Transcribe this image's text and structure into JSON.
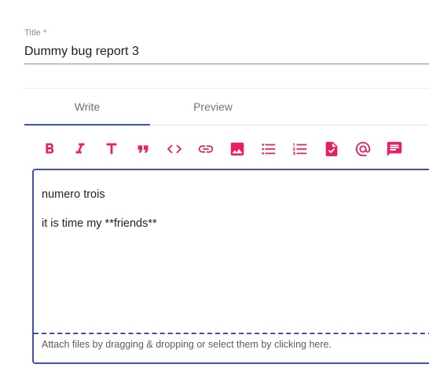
{
  "title_field": {
    "label": "Title *",
    "value": "Dummy bug report 3"
  },
  "tabs": [
    {
      "label": "Write",
      "selected": true
    },
    {
      "label": "Preview",
      "selected": false
    }
  ],
  "toolbar": {
    "color": "#e91e63",
    "items": [
      {
        "name": "bold-icon"
      },
      {
        "name": "italic-icon"
      },
      {
        "name": "header-icon"
      },
      {
        "name": "quote-icon"
      },
      {
        "name": "code-icon"
      },
      {
        "name": "link-icon"
      },
      {
        "name": "image-icon"
      },
      {
        "name": "bulleted-list-icon"
      },
      {
        "name": "numbered-list-icon"
      },
      {
        "name": "task-file-icon"
      },
      {
        "name": "mention-icon"
      },
      {
        "name": "comment-icon"
      }
    ]
  },
  "editor": {
    "lines": [
      "numero trois",
      "it is time my **friends**"
    ],
    "attach_hint": "Attach files by dragging & dropping or select them by clicking here.",
    "accent": "#3f51b5"
  }
}
